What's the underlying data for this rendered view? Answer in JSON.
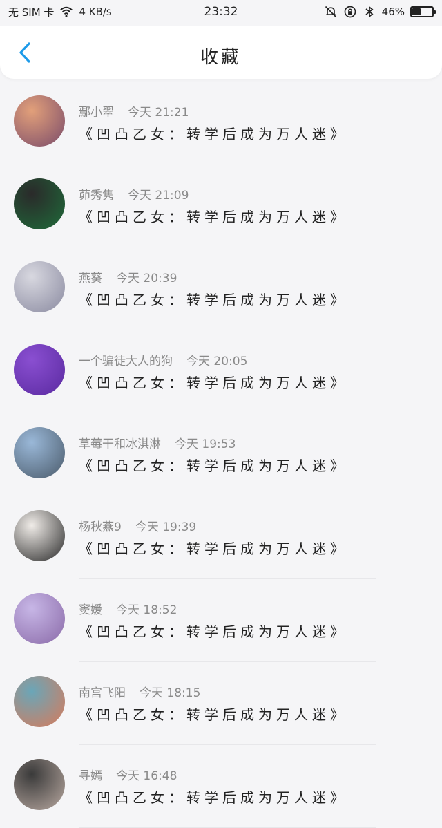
{
  "status_bar": {
    "carrier": "无 SIM 卡",
    "speed": "4 KB/s",
    "time": "23:32",
    "battery_percent": "46%",
    "battery_level": 0.46
  },
  "header": {
    "title": "收藏",
    "back_icon": "chevron-left-icon"
  },
  "favorites": [
    {
      "user": "鄢小翠",
      "time": "今天 21:21",
      "book": "《凹凸乙女：转学后成为万人迷》",
      "avatar_colors": [
        "#e2a07a",
        "#7a4b6a"
      ]
    },
    {
      "user": "茆秀隽",
      "time": "今天 21:09",
      "book": "《凹凸乙女：转学后成为万人迷》",
      "avatar_colors": [
        "#2a2a2a",
        "#1f6b3a"
      ]
    },
    {
      "user": "燕葵",
      "time": "今天 20:39",
      "book": "《凹凸乙女：转学后成为万人迷》",
      "avatar_colors": [
        "#d8d8e0",
        "#8a8aa0"
      ]
    },
    {
      "user": "一个骗徒大人的狗",
      "time": "今天 20:05",
      "book": "《凹凸乙女：转学后成为万人迷》",
      "avatar_colors": [
        "#8a4fd1",
        "#5a2aa0"
      ]
    },
    {
      "user": "草莓干和冰淇淋",
      "time": "今天 19:53",
      "book": "《凹凸乙女：转学后成为万人迷》",
      "avatar_colors": [
        "#9ab8d8",
        "#4a5a6a"
      ]
    },
    {
      "user": "杨秋燕9",
      "time": "今天 19:39",
      "book": "《凹凸乙女：转学后成为万人迷》",
      "avatar_colors": [
        "#f0ece8",
        "#2a2a2a"
      ]
    },
    {
      "user": "窦媛",
      "time": "今天 18:52",
      "book": "《凹凸乙女：转学后成为万人迷》",
      "avatar_colors": [
        "#c7b6e6",
        "#8a6aa8"
      ]
    },
    {
      "user": "南宫飞阳",
      "time": "今天 18:15",
      "book": "《凹凸乙女：转学后成为万人迷》",
      "avatar_colors": [
        "#6aa6b8",
        "#d87a5a"
      ]
    },
    {
      "user": "寻嫣",
      "time": "今天 16:48",
      "book": "《凹凸乙女：转学后成为万人迷》",
      "avatar_colors": [
        "#3a3a3a",
        "#b8a8a0"
      ]
    }
  ]
}
